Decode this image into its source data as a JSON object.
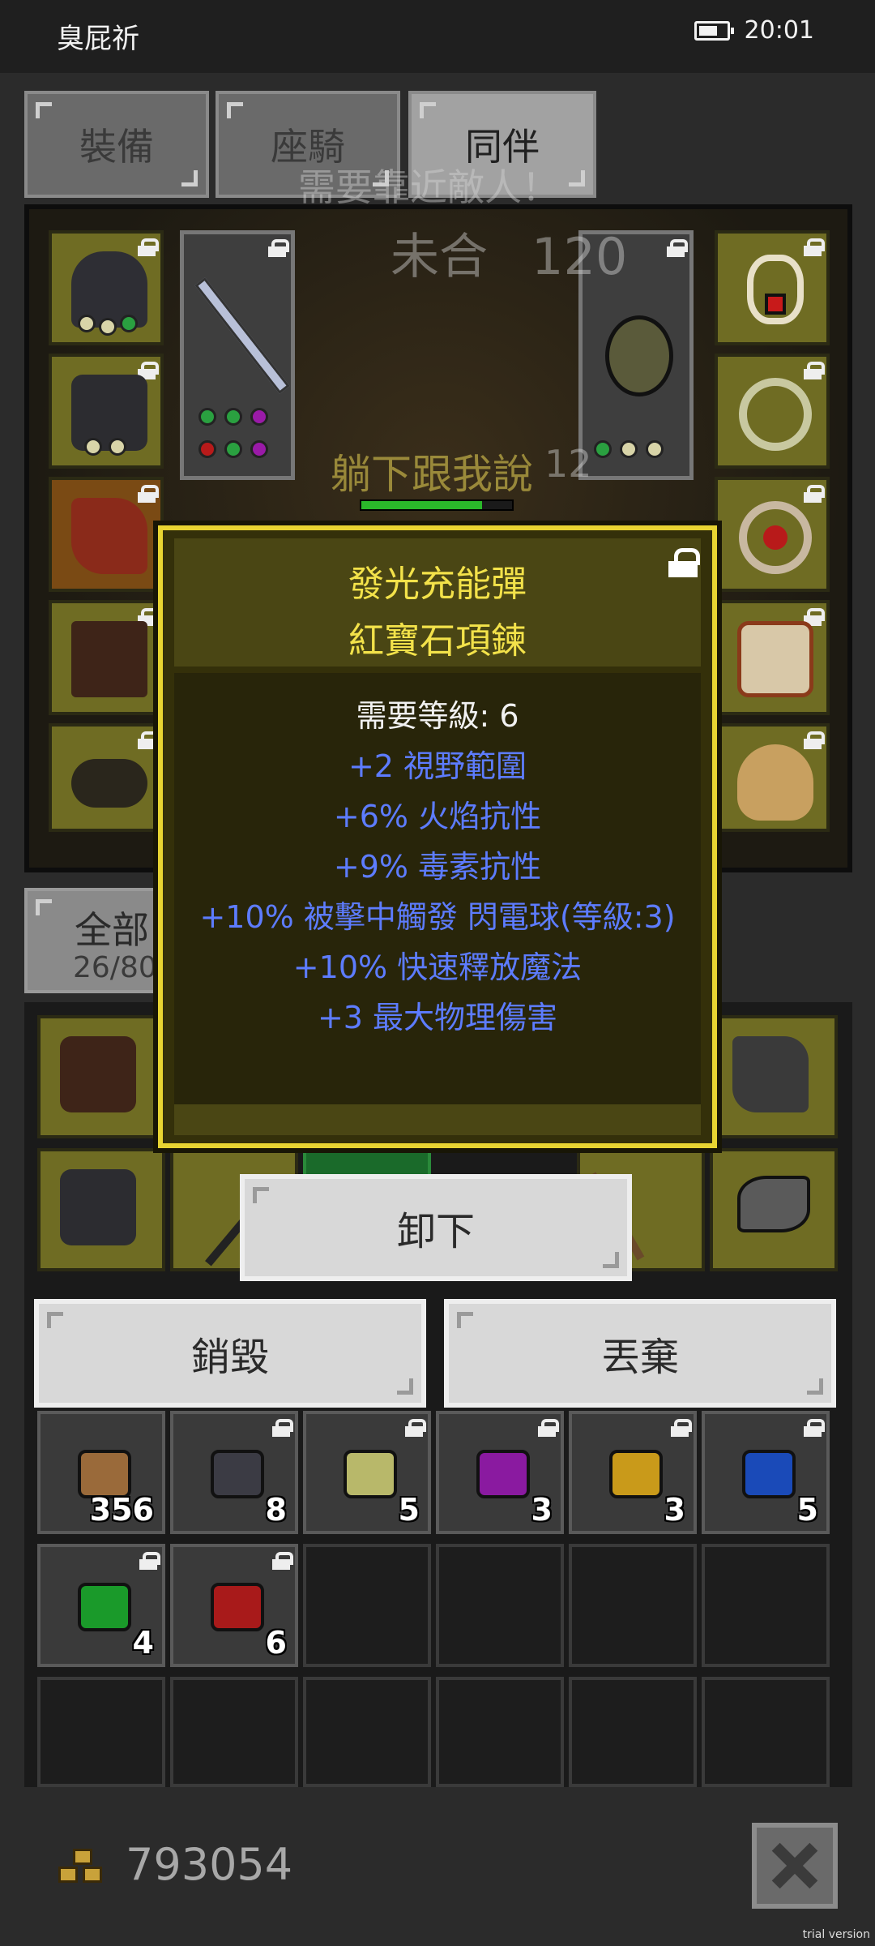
{
  "status_bar": {
    "app_name": "臭屁祈",
    "time": "20:01",
    "battery_icon": "battery-icon"
  },
  "tabs": [
    {
      "label": "裝備",
      "active": false
    },
    {
      "label": "座騎",
      "active": false
    },
    {
      "label": "同伴",
      "active": true
    }
  ],
  "overlay_text": {
    "approach_enemy": "需要靠近敵人！",
    "enemy_name": "未合",
    "enemy_value": "120",
    "chat_name": "躺下跟我說",
    "chat_suffix": "12"
  },
  "inventory": {
    "filter_label": "全部",
    "capacity": "26/80",
    "resources": [
      {
        "icon": "ore-icon",
        "count": "356",
        "color": "#9a6a3a"
      },
      {
        "icon": "dark-gem-icon",
        "count": "8",
        "color": "#3b3b44"
      },
      {
        "icon": "yellow-gem-icon",
        "count": "5",
        "color": "#b8b86a"
      },
      {
        "icon": "purple-gem-icon",
        "count": "3",
        "color": "#8a1aa0"
      },
      {
        "icon": "topaz-gem-icon",
        "count": "3",
        "color": "#c99a1a"
      },
      {
        "icon": "sapphire-gem-icon",
        "count": "5",
        "color": "#1a4ab8"
      },
      {
        "icon": "emerald-gem-icon",
        "count": "4",
        "color": "#1a9a2a"
      },
      {
        "icon": "ruby-gem-icon",
        "count": "6",
        "color": "#a81a1a"
      }
    ]
  },
  "tooltip": {
    "prefix": "發光充能彈",
    "name": "紅寶石項鍊",
    "requirement": "需要等級: 6",
    "stats": [
      "+2 視野範圍",
      "+6% 火焰抗性",
      "+9% 毒素抗性",
      "+10% 被擊中觸發 閃電球(等級:3)",
      "+10% 快速釋放魔法",
      "+3 最大物理傷害"
    ],
    "stat_color": "#5d7cff",
    "title_color": "#f3e24a"
  },
  "actions": {
    "unequip": "卸下",
    "destroy": "銷毀",
    "discard": "丟棄"
  },
  "footer": {
    "gold": "793054",
    "close_icon": "close-icon"
  },
  "watermark": "trial version"
}
